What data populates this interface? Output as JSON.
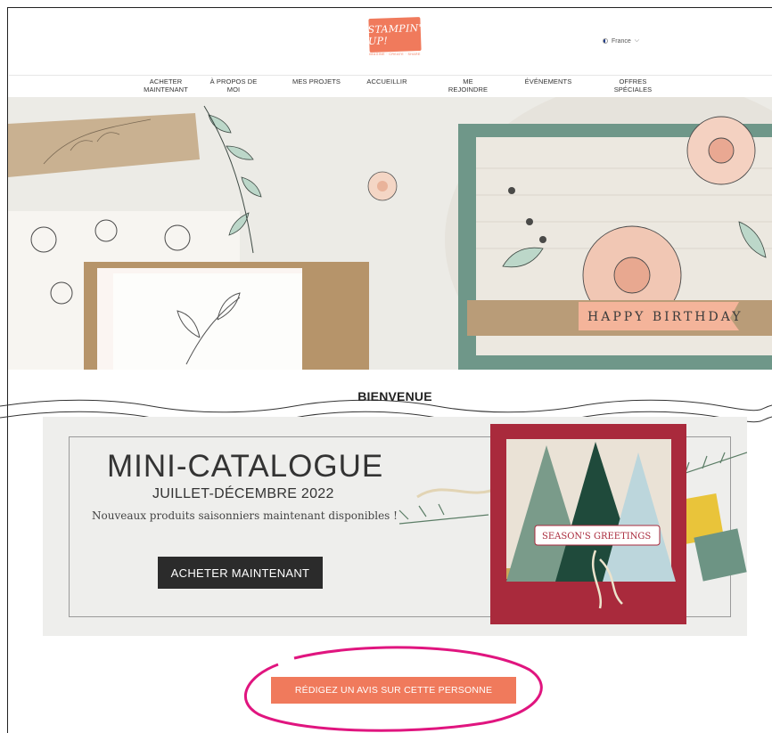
{
  "header": {
    "logo_text": "STAMPIN' UP!",
    "logo_tagline": "IMAGINE · CREATE · SHARE",
    "locale": "France"
  },
  "nav": {
    "items": [
      {
        "label": "ACHETER\nMAINTENANT"
      },
      {
        "label": "À PROPOS DE\nMOI"
      },
      {
        "label": "MES PROJETS"
      },
      {
        "label": "ACCUEILLIR"
      },
      {
        "label": "ME\nREJOINDRE"
      },
      {
        "label": "ÉVÉNEMENTS"
      },
      {
        "label": "OFFRES\nSPÉCIALES"
      }
    ]
  },
  "hero": {
    "banner_text": "HAPPY BIRTHDAY"
  },
  "welcome": "BIENVENUE",
  "promo": {
    "title": "MINI-CATALOGUE",
    "subtitle": "JUILLET-DÉCEMBRE 2022",
    "description": "Nouveaux produits saisonniers maintenant disponibles !",
    "button_label": "ACHETER MAINTENANT",
    "card_text": "SEASON'S GREETINGS"
  },
  "review": {
    "button_label": "RÉDIGEZ UN AVIS SUR CETTE PERSONNE"
  },
  "colors": {
    "brand": "#f07a5c",
    "highlight": "#e0157f",
    "dark_button": "#2b2b2b"
  }
}
